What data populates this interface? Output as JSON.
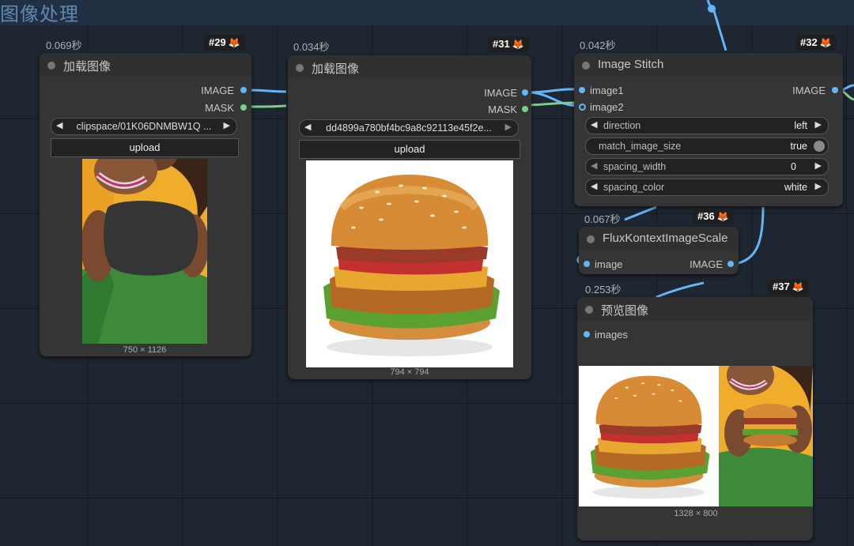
{
  "group": {
    "title": "图像处理"
  },
  "nodes": {
    "n29": {
      "time": "0.069秒",
      "id": "#29",
      "fox": "🦊",
      "title": "加载图像",
      "outputs": [
        "IMAGE",
        "MASK"
      ],
      "file": "clipspace/01K06DNMBW1Q ...",
      "upload": "upload",
      "size": "750 × 1126"
    },
    "n31": {
      "time": "0.034秒",
      "id": "#31",
      "fox": "🦊",
      "title": "加载图像",
      "outputs": [
        "IMAGE",
        "MASK"
      ],
      "file": "dd4899a780bf4bc9a8c92113e45f2e...",
      "upload": "upload",
      "size": "794 × 794"
    },
    "n32": {
      "time": "0.042秒",
      "id": "#32",
      "fox": "🦊",
      "title": "Image Stitch",
      "inputs": [
        "image1",
        "image2"
      ],
      "output": "IMAGE",
      "widgets": {
        "direction": {
          "label": "direction",
          "value": "left"
        },
        "match_image_size": {
          "label": "match_image_size",
          "value": "true"
        },
        "spacing_width": {
          "label": "spacing_width",
          "value": "0"
        },
        "spacing_color": {
          "label": "spacing_color",
          "value": "white"
        }
      }
    },
    "n36": {
      "time": "0.067秒",
      "id": "#36",
      "fox": "🦊",
      "title": "FluxKontextImageScale",
      "input": "image",
      "output": "IMAGE"
    },
    "n37": {
      "time": "0.253秒",
      "id": "#37",
      "fox": "🦊",
      "title": "预览图像",
      "input": "images",
      "size": "1328 × 800"
    }
  },
  "colors": {
    "image_wire": "#64b5f6",
    "mask_wire": "#7ccf8a",
    "node_bg": "#353535",
    "canvas_bg": "#1e2632",
    "group_title": "#5f88b5"
  }
}
